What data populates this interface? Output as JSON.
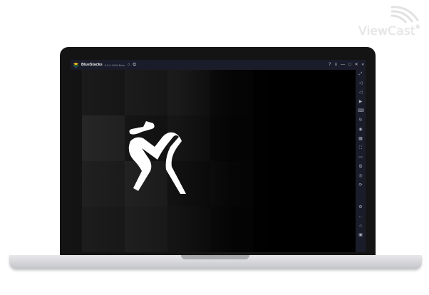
{
  "watermark": {
    "text": "ViewCast",
    "reg_mark": "®"
  },
  "emulator": {
    "app_name": "BlueStacks",
    "version": "5.9.0.1008 Beta",
    "titlebar_icons": [
      "home-icon",
      "multi-instance-icon"
    ],
    "window_controls": [
      "help-icon",
      "menu-icon",
      "minimize-icon",
      "maximize-icon",
      "close-icon",
      "collapse-icon"
    ],
    "sidebar_tools": [
      "fullscreen-icon",
      "volume-up-icon",
      "volume-down-icon",
      "play-icon",
      "keyboard-icon",
      "rotate-icon",
      "gamepad-icon",
      "macro-icon",
      "screenshot-icon",
      "folder-icon",
      "multi-window-icon",
      "eco-mode-icon",
      "sync-icon",
      "settings-icon",
      "back-icon",
      "home-icon",
      "recent-apps-icon"
    ]
  },
  "app": {
    "logo": "climber-icon"
  },
  "colors": {
    "titlebar": "#1a1d29",
    "logo": "#ffffff",
    "laptop_bezel": "#141414",
    "laptop_base": "#d6d7da"
  }
}
